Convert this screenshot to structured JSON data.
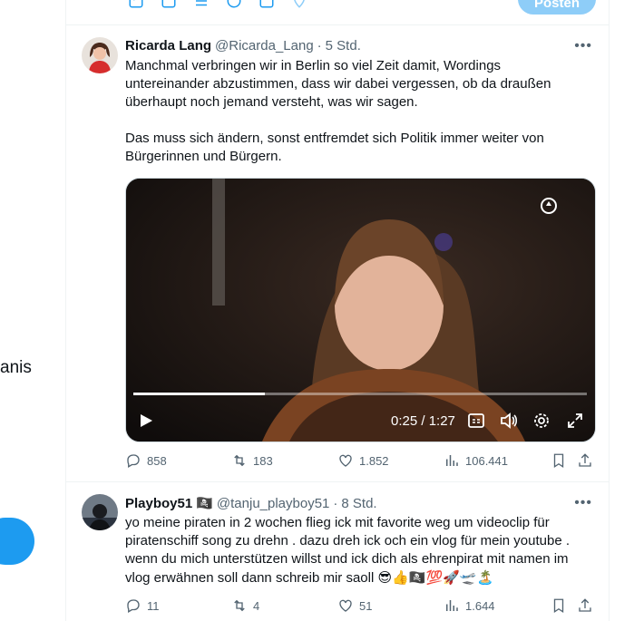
{
  "composer": {
    "post_label": "Posten"
  },
  "left": {
    "fragment": "anis"
  },
  "tweets": [
    {
      "name": "Ricarda Lang",
      "handle": "@Ricarda_Lang",
      "sep": "·",
      "time": "5 Std.",
      "text_p1_l1": "Manchmal verbringen wir in Berlin so viel Zeit damit, Wordings",
      "text_p1_l2": "untereinander abzustimmen, dass wir dabei vergessen, ob da draußen",
      "text_p1_l3": "überhaupt noch jemand versteht, was wir sagen.",
      "text_p2_l1": "Das muss sich ändern, sonst entfremdet sich Politik immer weiter von",
      "text_p2_l2": "Bürgerinnen und Bürgern.",
      "video": {
        "time": "0:25 / 1:27",
        "progress": 0.29
      },
      "replies": "858",
      "reposts": "183",
      "likes": "1.852",
      "views": "106.441"
    },
    {
      "name": "Playboy51",
      "name_emoji": "🏴‍☠️",
      "handle": "@tanju_playboy51",
      "sep": "·",
      "time": "8 Std.",
      "text_l1": "yo meine piraten in 2 wochen flieg ick mit favorite weg um videoclip für",
      "text_l2": "piratenschiff song zu drehn . dazu dreh ick och ein vlog für mein youtube .",
      "text_l3": "wenn du mich unterstützen willst und ick dich als ehrenpirat mit namen im",
      "text_l4": "vlog erwähnen soll dann schreib mir saoll",
      "text_l4_emojis": "😎👍🏴‍☠️💯🚀🛫🏝️",
      "replies": "11",
      "reposts": "4",
      "likes": "51",
      "views": "1.644"
    }
  ],
  "colors": {
    "accent": "#1d9bf0",
    "muted": "#536471",
    "post_disabled": "#8ecdf8"
  }
}
